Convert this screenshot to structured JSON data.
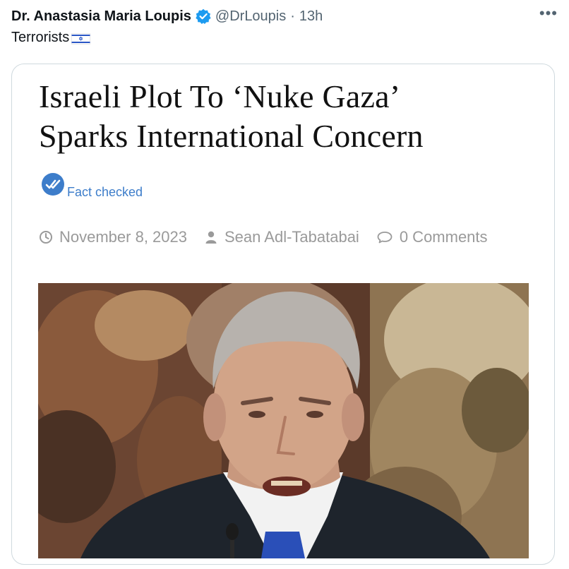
{
  "post": {
    "author_name": "Dr. Anastasia Maria Loupis",
    "handle": "@DrLoupis",
    "separator": "·",
    "time": "13h",
    "more_label": "•••",
    "text": "Terrorists",
    "flag_icon": "israel-flag-icon"
  },
  "card": {
    "headline_line1": "Israeli Plot To ‘Nuke Gaza’",
    "headline_line2": "Sparks International Concern",
    "fact_check_label": "Fact checked",
    "date": "November 8, 2023",
    "author": "Sean Adl-Tabatabai",
    "comments": "0 Comments"
  },
  "colors": {
    "verified_blue": "#1d9bf0",
    "fact_blue": "#3d7dca",
    "meta_gray": "#9a9a9a",
    "border": "#cfd9de"
  }
}
